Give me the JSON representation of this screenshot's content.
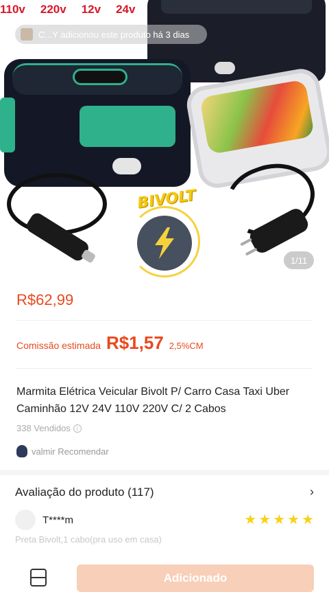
{
  "hero": {
    "voltages": [
      "110v",
      "220v",
      "12v",
      "24v"
    ],
    "activity_text": "C...Y adicionou este produto há 3 dias",
    "badge_text": "BIVOLT",
    "image_counter": "1/11"
  },
  "product": {
    "price": "R$62,99",
    "commission_label": "Comissão estimada",
    "commission_value": "R$1,57",
    "commission_pct": "2,5%CM",
    "title": "Marmita Elétrica Veicular Bivolt P/ Carro Casa Taxi Uber Caminhão 12V 24V 110V 220V C/ 2 Cabos",
    "sold": "338 Vendidos",
    "recommend": "valmir Recomendar"
  },
  "reviews": {
    "header": "Avaliação do produto (117)",
    "reviewer_name": "T****m",
    "rating": 5,
    "variant": "Preta Bivolt,1 cabo(pra uso em casa)"
  },
  "bottom": {
    "add_button": "Adicionado"
  },
  "colors": {
    "accent": "#e8491d",
    "star": "#f6d21a",
    "button_disabled": "#f8cfb8"
  }
}
